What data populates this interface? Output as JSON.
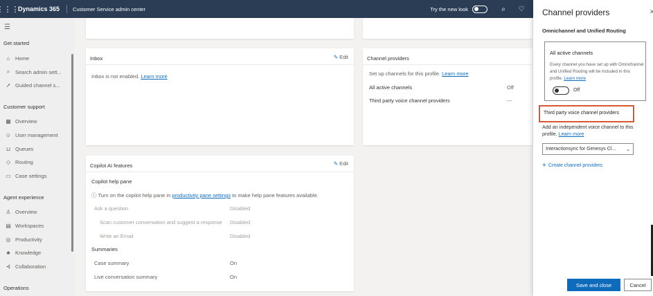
{
  "topbar": {
    "brand": "Dynamics 365",
    "app_name": "Customer Service admin center",
    "try_new_look": "Try the new look"
  },
  "sidebar": {
    "sections": [
      {
        "label": "Get started"
      },
      {
        "label": "Customer support"
      },
      {
        "label": "Agent experience"
      },
      {
        "label": "Operations"
      }
    ],
    "items": [
      {
        "label": "Home",
        "icon": "home-icon"
      },
      {
        "label": "Search admin sett...",
        "icon": "search-icon"
      },
      {
        "label": "Guided channel s...",
        "icon": "rocket-icon"
      },
      {
        "label": "Overview",
        "icon": "dashboard-icon"
      },
      {
        "label": "User management",
        "icon": "users-icon"
      },
      {
        "label": "Queues",
        "icon": "inbox-icon"
      },
      {
        "label": "Routing",
        "icon": "routing-icon"
      },
      {
        "label": "Case settings",
        "icon": "case-icon"
      },
      {
        "label": "Overview",
        "icon": "person-icon"
      },
      {
        "label": "Workspaces",
        "icon": "workspace-icon"
      },
      {
        "label": "Productivity",
        "icon": "productivity-icon"
      },
      {
        "label": "Knowledge",
        "icon": "knowledge-icon"
      },
      {
        "label": "Collaboration",
        "icon": "collaboration-icon"
      }
    ]
  },
  "inbox_card": {
    "title": "Inbox",
    "edit_label": "Edit",
    "text": "Inbox is not enabled.",
    "link": "Learn more"
  },
  "channel_card": {
    "title": "Channel providers",
    "setup_text": "Set up channels for this profile.",
    "setup_link": "Learn more",
    "rows": [
      {
        "label": "All active channels",
        "value": "Off"
      },
      {
        "label": "Third party voice channel providers",
        "value": "---"
      }
    ]
  },
  "copilot_card": {
    "title": "Copilot AI features",
    "edit_label": "Edit",
    "help_pane_heading": "Copilot help pane",
    "info_prefix": "Turn on the copilot help pane in",
    "info_link": "productivity pane settings",
    "info_suffix": "to make help pane features available.",
    "help_rows": [
      {
        "label": "Ask a question",
        "value": "Disabled"
      },
      {
        "label": "Scan customer conversation and suggest a response",
        "value": "Disabled"
      },
      {
        "label": "Write an Email",
        "value": "Disabled"
      }
    ],
    "summaries_heading": "Summaries",
    "summary_rows": [
      {
        "label": "Case summary",
        "value": "On"
      },
      {
        "label": "Live conversation summary",
        "value": "On"
      }
    ]
  },
  "panel": {
    "title": "Channel providers",
    "subtitle": "Omnichannel and Unified Routing",
    "all_active": {
      "title": "All active channels",
      "description": "Every channel you have set up with Omnichannel and Unified Routing will be included in this profile.",
      "link": "Learn more",
      "toggle_label": "Off",
      "toggle_on": false
    },
    "third_party_heading": "Third party voice channel providers",
    "third_party_desc": "Add an independent voice channel to this profile.",
    "third_party_link": "Learn more",
    "select_value": "Interactionsync for Genesys Cl...",
    "create_label": "Create channel providers",
    "save_label": "Save and close",
    "cancel_label": "Cancel"
  },
  "colors": {
    "topbar": "#2b3d55",
    "accent": "#0f6cbd",
    "highlight": "#d9572c"
  }
}
